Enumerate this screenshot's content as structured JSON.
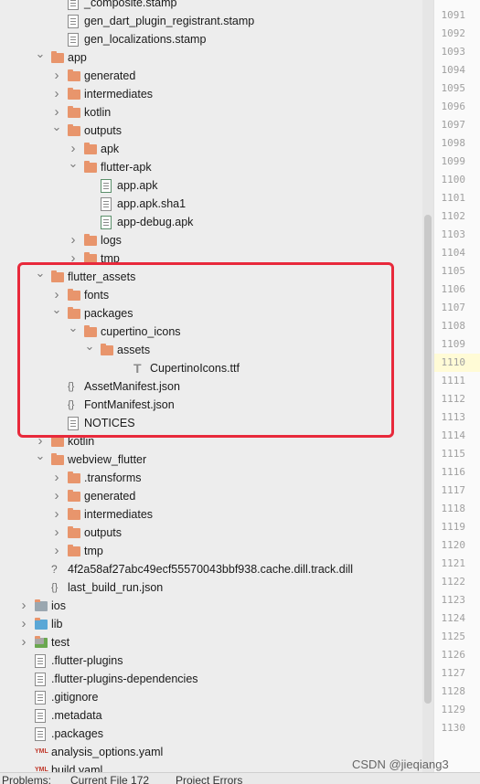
{
  "tree": {
    "rows": [
      {
        "label": "_composite.stamp",
        "icon": "stamp-file-icon",
        "kind": "file",
        "depth": 3,
        "chev": ""
      },
      {
        "label": "gen_dart_plugin_registrant.stamp",
        "icon": "stamp-file-icon",
        "kind": "file",
        "depth": 3,
        "chev": ""
      },
      {
        "label": "gen_localizations.stamp",
        "icon": "stamp-file-icon",
        "kind": "file",
        "depth": 3,
        "chev": ""
      },
      {
        "label": "app",
        "icon": "folder-icon",
        "kind": "folder",
        "depth": 2,
        "chev": "down"
      },
      {
        "label": "generated",
        "icon": "folder-icon",
        "kind": "folder",
        "depth": 3,
        "chev": "right"
      },
      {
        "label": "intermediates",
        "icon": "folder-icon",
        "kind": "folder",
        "depth": 3,
        "chev": "right"
      },
      {
        "label": "kotlin",
        "icon": "folder-icon",
        "kind": "folder",
        "depth": 3,
        "chev": "right"
      },
      {
        "label": "outputs",
        "icon": "folder-icon",
        "kind": "folder",
        "depth": 3,
        "chev": "down"
      },
      {
        "label": "apk",
        "icon": "folder-icon",
        "kind": "folder",
        "depth": 4,
        "chev": "right"
      },
      {
        "label": "flutter-apk",
        "icon": "folder-icon",
        "kind": "folder",
        "depth": 4,
        "chev": "down"
      },
      {
        "label": "app.apk",
        "icon": "apk-file-icon",
        "kind": "apk",
        "depth": 5,
        "chev": ""
      },
      {
        "label": "app.apk.sha1",
        "icon": "text-file-icon",
        "kind": "file",
        "depth": 5,
        "chev": ""
      },
      {
        "label": "app-debug.apk",
        "icon": "apk-file-icon",
        "kind": "apk",
        "depth": 5,
        "chev": ""
      },
      {
        "label": "logs",
        "icon": "folder-icon",
        "kind": "folder",
        "depth": 4,
        "chev": "right"
      },
      {
        "label": "tmp",
        "icon": "folder-icon",
        "kind": "folder",
        "depth": 4,
        "chev": "right"
      },
      {
        "label": "flutter_assets",
        "icon": "folder-icon",
        "kind": "folder",
        "depth": 2,
        "chev": "down"
      },
      {
        "label": "fonts",
        "icon": "folder-icon",
        "kind": "folder",
        "depth": 3,
        "chev": "right"
      },
      {
        "label": "packages",
        "icon": "folder-icon",
        "kind": "folder",
        "depth": 3,
        "chev": "down"
      },
      {
        "label": "cupertino_icons",
        "icon": "folder-icon",
        "kind": "folder",
        "depth": 4,
        "chev": "down"
      },
      {
        "label": "assets",
        "icon": "folder-icon",
        "kind": "folder",
        "depth": 5,
        "chev": "down"
      },
      {
        "label": "CupertinoIcons.ttf",
        "icon": "font-file-icon",
        "kind": "font",
        "depth": 7,
        "chev": ""
      },
      {
        "label": "AssetManifest.json",
        "icon": "json-file-icon",
        "kind": "json",
        "depth": 3,
        "chev": ""
      },
      {
        "label": "FontManifest.json",
        "icon": "json-file-icon",
        "kind": "json",
        "depth": 3,
        "chev": ""
      },
      {
        "label": "NOTICES",
        "icon": "text-file-icon",
        "kind": "file",
        "depth": 3,
        "chev": ""
      },
      {
        "label": "kotlin",
        "icon": "folder-icon",
        "kind": "folder",
        "depth": 2,
        "chev": "right"
      },
      {
        "label": "webview_flutter",
        "icon": "folder-icon",
        "kind": "folder",
        "depth": 2,
        "chev": "down"
      },
      {
        "label": ".transforms",
        "icon": "folder-icon",
        "kind": "folder",
        "depth": 3,
        "chev": "right"
      },
      {
        "label": "generated",
        "icon": "folder-icon",
        "kind": "folder",
        "depth": 3,
        "chev": "right"
      },
      {
        "label": "intermediates",
        "icon": "folder-icon",
        "kind": "folder",
        "depth": 3,
        "chev": "right"
      },
      {
        "label": "outputs",
        "icon": "folder-icon",
        "kind": "folder",
        "depth": 3,
        "chev": "right"
      },
      {
        "label": "tmp",
        "icon": "folder-icon",
        "kind": "folder",
        "depth": 3,
        "chev": "right"
      },
      {
        "label": "4f2a58af27abc49ecf55570043bbf938.cache.dill.track.dill",
        "icon": "unknown-file-icon",
        "kind": "unknown",
        "depth": 2,
        "chev": ""
      },
      {
        "label": "last_build_run.json",
        "icon": "json-file-icon",
        "kind": "json",
        "depth": 2,
        "chev": ""
      },
      {
        "label": "ios",
        "icon": "gray-folder-icon",
        "kind": "gfolder",
        "depth": 1,
        "chev": "right"
      },
      {
        "label": "lib",
        "icon": "blue-folder-icon",
        "kind": "bfolder",
        "depth": 1,
        "chev": "right"
      },
      {
        "label": "test",
        "icon": "test-folder-icon",
        "kind": "tfolder",
        "depth": 1,
        "chev": "right"
      },
      {
        "label": ".flutter-plugins",
        "icon": "text-file-icon",
        "kind": "file",
        "depth": 1,
        "chev": ""
      },
      {
        "label": ".flutter-plugins-dependencies",
        "icon": "text-file-icon",
        "kind": "file",
        "depth": 1,
        "chev": ""
      },
      {
        "label": ".gitignore",
        "icon": "gitignore-file-icon",
        "kind": "file",
        "depth": 1,
        "chev": ""
      },
      {
        "label": ".metadata",
        "icon": "text-file-icon",
        "kind": "file",
        "depth": 1,
        "chev": ""
      },
      {
        "label": ".packages",
        "icon": "text-file-icon",
        "kind": "file",
        "depth": 1,
        "chev": ""
      },
      {
        "label": "analysis_options.yaml",
        "icon": "yaml-file-icon",
        "kind": "yaml",
        "depth": 1,
        "chev": ""
      },
      {
        "label": "build.yaml",
        "icon": "yaml-file-icon",
        "kind": "yaml",
        "depth": 1,
        "chev": ""
      }
    ]
  },
  "gutter": {
    "line_numbers": [
      "1091",
      "1092",
      "1093",
      "1094",
      "1095",
      "1096",
      "1097",
      "1098",
      "1099",
      "1100",
      "1101",
      "1102",
      "1103",
      "1104",
      "1105",
      "1106",
      "1107",
      "1108",
      "1109",
      "1110",
      "1111",
      "1112",
      "1113",
      "1114",
      "1115",
      "1116",
      "1117",
      "1118",
      "1119",
      "1120",
      "1121",
      "1122",
      "1123",
      "1124",
      "1125",
      "1126",
      "1127",
      "1128",
      "1129",
      "1130"
    ],
    "highlighted": "1110"
  },
  "bottom_bar": {
    "problems": "Problems:",
    "current_file": "Current File 172",
    "project_errors": "Project Errors"
  },
  "watermark": "CSDN @jieqiang3",
  "colors": {
    "folder": "#e8956c",
    "highlight_box": "#e8293b",
    "apk_badge": "#3ddc84",
    "line_highlight": "#fffbd6"
  }
}
